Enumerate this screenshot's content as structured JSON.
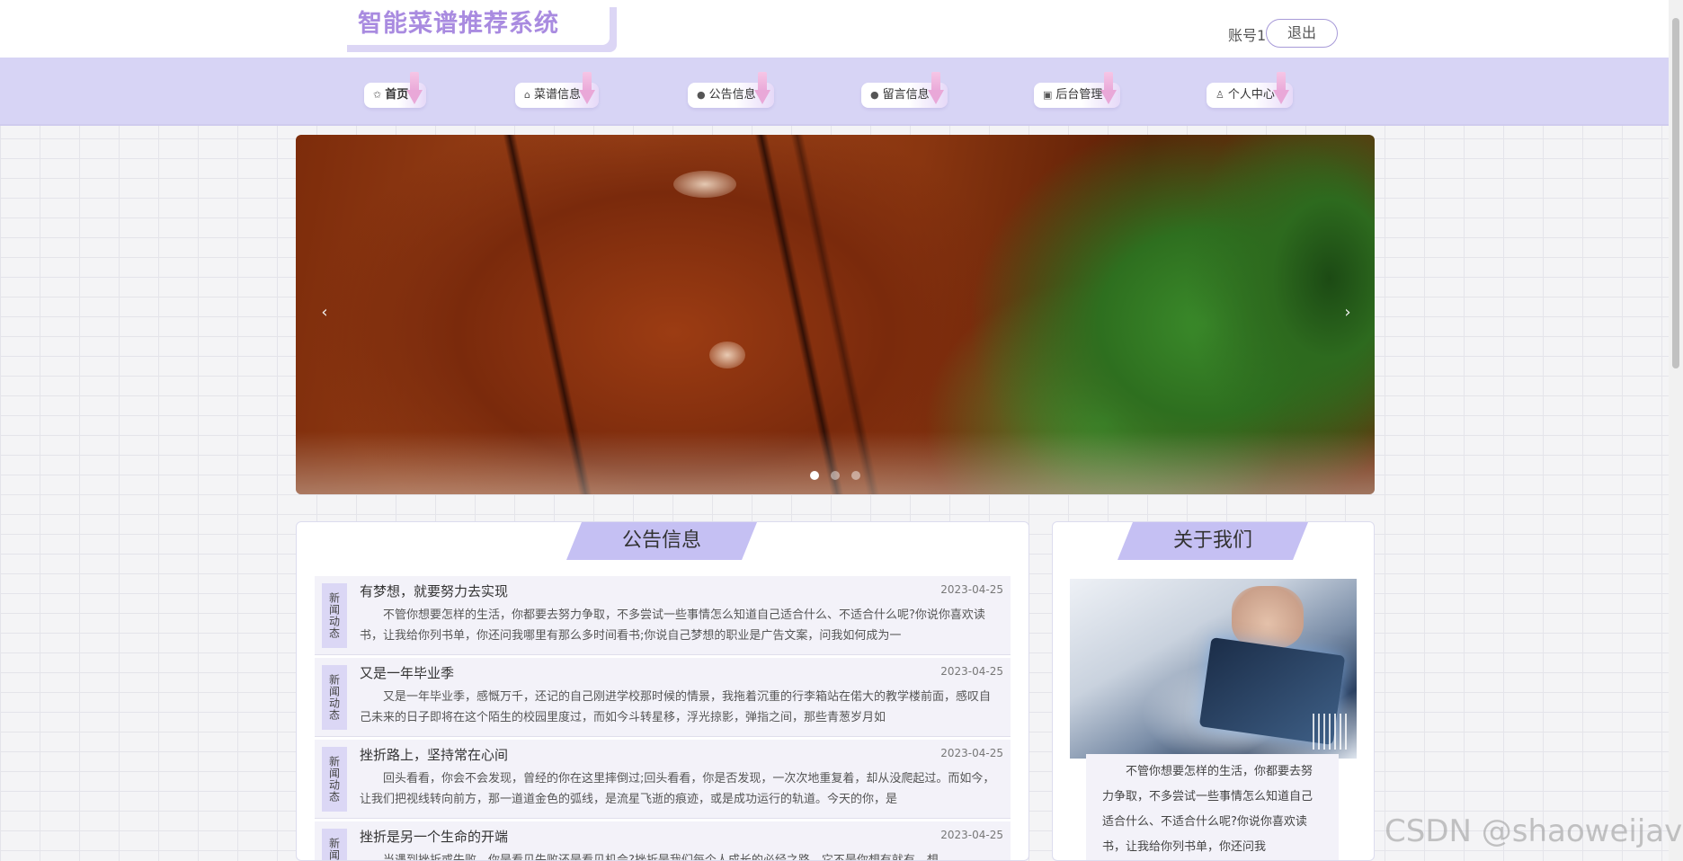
{
  "header": {
    "app_title": "智能菜谱推荐系统",
    "account_label": "账号1",
    "logout_label": "退出"
  },
  "nav": {
    "items": [
      {
        "label": "首页",
        "icon": "star-icon",
        "glyph": "✩"
      },
      {
        "label": "菜谱信息",
        "icon": "bag-icon",
        "glyph": "⌂"
      },
      {
        "label": "公告信息",
        "icon": "info-circle-icon",
        "glyph": "●"
      },
      {
        "label": "留言信息",
        "icon": "question-circle-icon",
        "glyph": "●"
      },
      {
        "label": "后台管理",
        "icon": "briefcase-icon",
        "glyph": "▣"
      },
      {
        "label": "个人中心",
        "icon": "user-icon",
        "glyph": "♙"
      }
    ]
  },
  "banner": {
    "prev": "‹",
    "next": "›",
    "slide_count": 3,
    "active_slide": 1
  },
  "notices": {
    "title": "公告信息",
    "items": [
      {
        "tag": "新闻动态",
        "title": "有梦想，就要努力去实现",
        "date": "2023-04-25",
        "summary": "不管你想要怎样的生活，你都要去努力争取，不多尝试一些事情怎么知道自己适合什么、不适合什么呢?你说你喜欢读书，让我给你列书单，你还问我哪里有那么多时间看书;你说自己梦想的职业是广告文案，问我如何成为一"
      },
      {
        "tag": "新闻动态",
        "title": "又是一年毕业季",
        "date": "2023-04-25",
        "summary": "又是一年毕业季，感慨万千，还记的自己刚进学校那时候的情景，我拖着沉重的行李箱站在偌大的教学楼前面，感叹自己未来的日子即将在这个陌生的校园里度过，而如今斗转星移，浮光掠影，弹指之间，那些青葱岁月如"
      },
      {
        "tag": "新闻动态",
        "title": "挫折路上，坚持常在心间",
        "date": "2023-04-25",
        "summary": "回头看看，你会不会发现，曾经的你在这里摔倒过;回头看看，你是否发现，一次次地重复着，却从没爬起过。而如今，让我们把视线转向前方，那一道道金色的弧线，是流星飞逝的痕迹，或是成功运行的轨道。今天的你，是"
      },
      {
        "tag": "新闻动态",
        "title": "挫折是另一个生命的开端",
        "date": "2023-04-25",
        "summary": "当遇到挫折或失败，你是看见失败还是看见机会?挫折是我们每个人成长的必经之路，它不是你想有就有，想"
      }
    ]
  },
  "about": {
    "title": "关于我们",
    "text": "不管你想要怎样的生活，你都要去努力争取，不多尝试一些事情怎么知道自己适合什么、不适合什么呢?你说你喜欢读书，让我给你列书单，你还问我"
  },
  "watermark": "CSDN @shaoweijava",
  "colors": {
    "accent": "#a98be0",
    "nav_bg": "#d7d4f5",
    "panel_title_bg": "#c5c0f3"
  }
}
